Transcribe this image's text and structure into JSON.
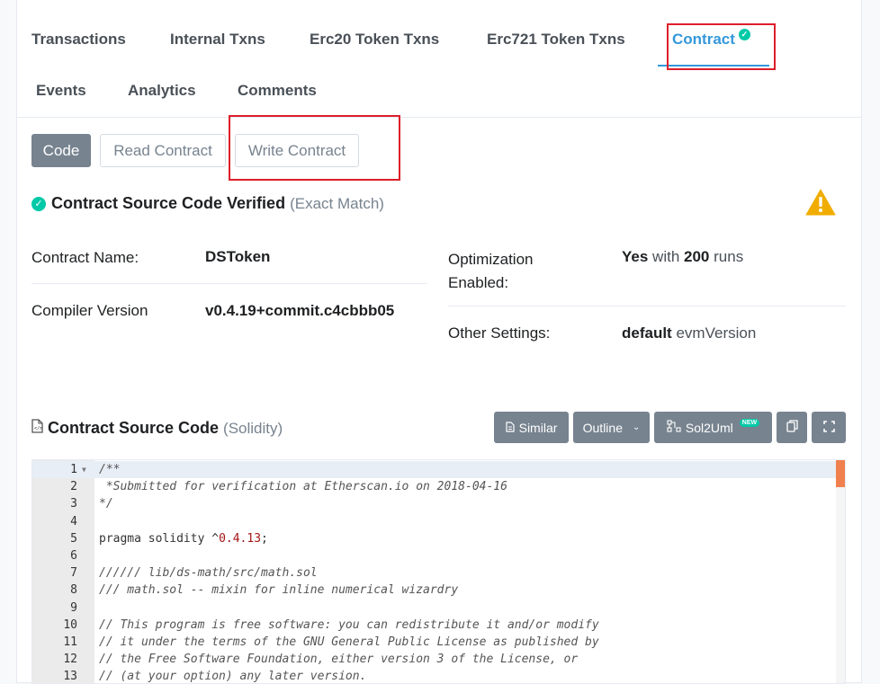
{
  "tabs": [
    {
      "label": "Transactions"
    },
    {
      "label": "Internal Txns"
    },
    {
      "label": "Erc20 Token Txns"
    },
    {
      "label": "Erc721 Token Txns"
    },
    {
      "label": "Contract",
      "active": true
    },
    {
      "label": "Events"
    },
    {
      "label": "Analytics"
    },
    {
      "label": "Comments"
    }
  ],
  "subtabs": {
    "code": "Code",
    "read": "Read Contract",
    "write": "Write Contract"
  },
  "verified": {
    "title": "Contract Source Code Verified",
    "match": "(Exact Match)"
  },
  "info": {
    "contract_name_label": "Contract Name:",
    "contract_name_value": "DSToken",
    "compiler_label": "Compiler Version",
    "compiler_value": "v0.4.19+commit.c4cbbb05",
    "optimization_label": "Optimization Enabled:",
    "optimization_yes": "Yes",
    "optimization_with": "with",
    "optimization_runs": "200",
    "optimization_runs_word": "runs",
    "other_label": "Other Settings:",
    "other_value": "default",
    "other_suffix": "evmVersion"
  },
  "source": {
    "title": "Contract Source Code",
    "lang": "(Solidity)",
    "similar": "Similar",
    "outline": "Outline",
    "sol2uml": "Sol2Uml",
    "new_badge": "NEW"
  },
  "code_lines": [
    {
      "n": "1",
      "text": "/**",
      "type": "comment"
    },
    {
      "n": "2",
      "text": " *Submitted for verification at Etherscan.io on 2018-04-16",
      "type": "comment"
    },
    {
      "n": "3",
      "text": "*/",
      "type": "comment"
    },
    {
      "n": "4",
      "text": "",
      "type": "code"
    },
    {
      "n": "5",
      "text": "pragma solidity ^0.4.13;",
      "type": "pragma"
    },
    {
      "n": "6",
      "text": "",
      "type": "code"
    },
    {
      "n": "7",
      "text": "////// lib/ds-math/src/math.sol",
      "type": "comment"
    },
    {
      "n": "8",
      "text": "/// math.sol -- mixin for inline numerical wizardry",
      "type": "comment"
    },
    {
      "n": "9",
      "text": "",
      "type": "code"
    },
    {
      "n": "10",
      "text": "// This program is free software: you can redistribute it and/or modify",
      "type": "comment"
    },
    {
      "n": "11",
      "text": "// it under the terms of the GNU General Public License as published by",
      "type": "comment"
    },
    {
      "n": "12",
      "text": "// the Free Software Foundation, either version 3 of the License, or",
      "type": "comment"
    },
    {
      "n": "13",
      "text": "// (at your option) any later version.",
      "type": "comment"
    }
  ],
  "colors": {
    "accent": "#3498db",
    "highlight_box": "#de1e2a",
    "verified_green": "#00c9a7",
    "warning": "#f0ad00"
  }
}
